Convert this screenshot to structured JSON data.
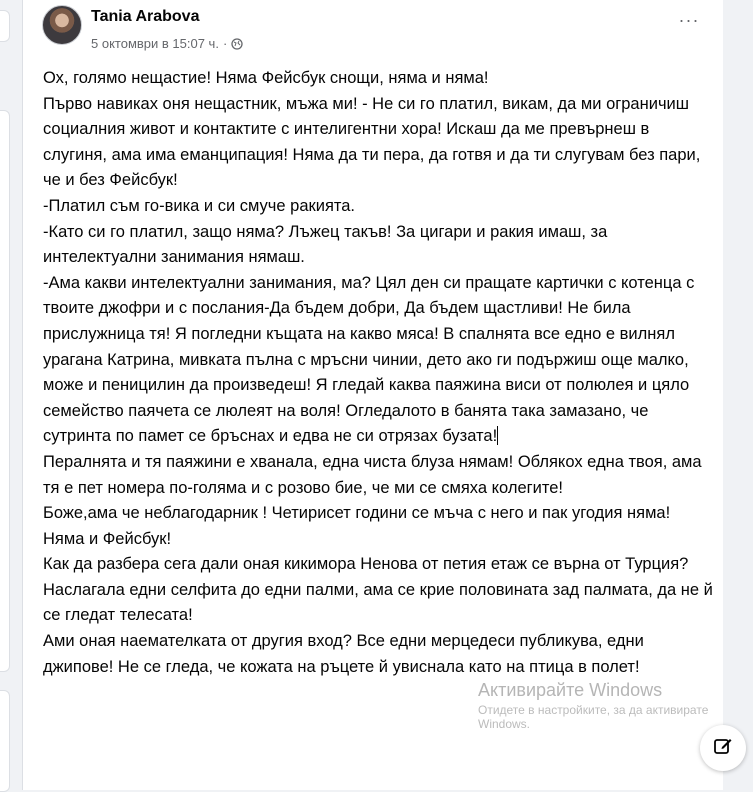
{
  "post": {
    "author": "Tania Arabova",
    "timestamp": "5 октомври в 15:07 ч.",
    "separator": "·",
    "privacy_icon": "globe-icon",
    "more_icon": "···",
    "paragraphs": [
      "Ох, голямо нещастие! Няма Фейсбук снощи, няма и няма!",
      "Първо навиках оня нещастник, мъжа ми! - Не си го платил, викам, да ми ограничиш социалния живот и контактите с интелигентни хора! Искаш да ме превърнеш в слугиня, ама има еманципация! Няма да ти пера, да готвя и да ти слугувам без пари, че и без Фейсбук!",
      "-Платил съм го-вика и си смуче ракията.",
      "-Като си го платил, защо няма? Лъжец такъв! За цигари и ракия имаш, за интелектуални занимания нямаш.",
      "-Ама какви интелектуални занимания, ма? Цял ден си пращате картички с котенца с твоите джофри и с послания-Да бъдем добри, Да бъдем щастливи! Не била прислужница тя! Я погледни къщата на какво мяса! В спалнята все едно е вилнял урагана Катрина, мивката пълна с мръсни чинии, дето ако ги подържиш още малко, може и пеницилин да произведеш! Я гледай каква паяжина виси от полюлея и цяло семейство паячета се люлеят на воля! Огледалото в банята така замазано, че сутринта по памет се бръснах и едва не си отрязах бузата!",
      "Пералнята и тя паяжини е хванала, една чиста блуза нямам! Облякох една твоя, ама тя е пет номера по-голяма и с розово бие, че ми се смяха колегите!",
      "Боже,ама че неблагодарник ! Четирисет години се мъча с него и пак угодия няма!",
      "Няма и Фейсбук!",
      "Как да разбера сега дали оная кикимора Ненова от петия етаж се върна от Турция? Наслагала едни селфита до едни палми, ама се крие половината зад палмата, да не й се гледат телесата!",
      "Ами оная наемателката от другия вход? Все едни мерцедеси публикува, едни джипове! Не се гледа, че кожата на ръцете й увиснала като на птица в полет!"
    ]
  },
  "overlay": {
    "watermark_title": "Активирайте Windows",
    "watermark_subtitle": "Отидете в настройките, за да активирате Windows."
  },
  "compose": {
    "icon": "edit-icon"
  },
  "colors": {
    "background": "#f0f2f5",
    "card": "#ffffff",
    "text": "#050505",
    "meta": "#65676b"
  }
}
